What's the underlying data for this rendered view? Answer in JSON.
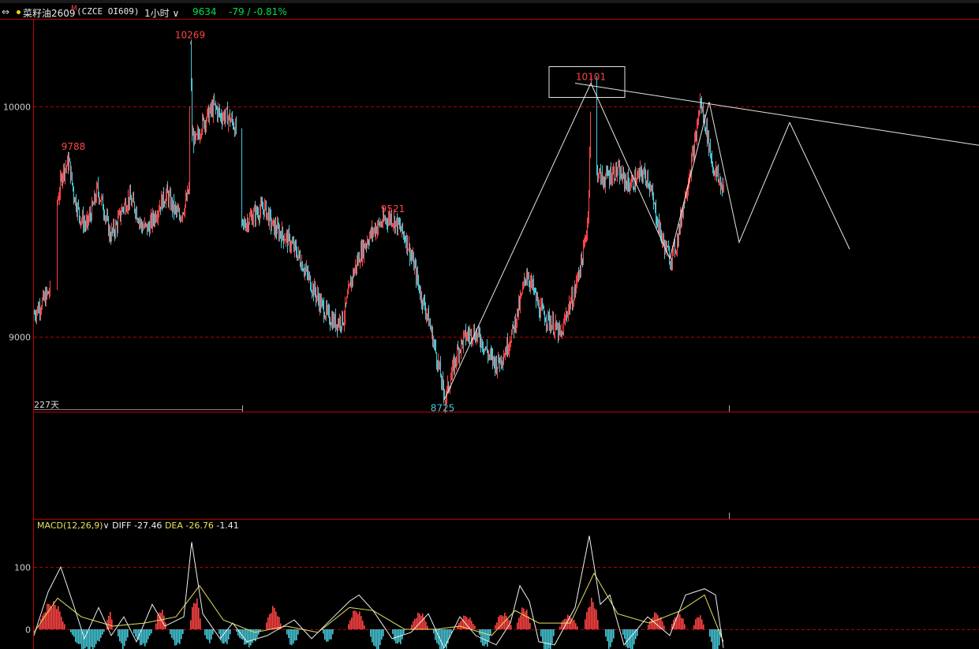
{
  "header": {
    "menu_icon": "⇔",
    "dot_color": "#ffd200",
    "instrument_name": "菜籽油2609",
    "superscript": "M",
    "code": "(CZCE OI609)",
    "period": "1小时",
    "last_price": "9634",
    "change": "-79 / -0.81%"
  },
  "colors": {
    "up": "#ff4444",
    "down": "#46c8d8",
    "grid": "#b40000",
    "axis": "#c00000",
    "white": "#e6e6e6",
    "price_text": "#ffff00",
    "change_text": "#00e050",
    "diff_line": "#f0f0f0",
    "dea_line": "#e8e060"
  },
  "chart_data": [
    {
      "type": "candlestick",
      "yticks": [
        10000,
        9000
      ],
      "ylim": [
        8680,
        10360
      ],
      "span_label": "227天",
      "annotations": [
        {
          "label": "10269",
          "kind": "high"
        },
        {
          "label": "9788",
          "kind": "high"
        },
        {
          "label": "9521",
          "kind": "high"
        },
        {
          "label": "10101",
          "kind": "high"
        },
        {
          "label": "8725",
          "kind": "low"
        }
      ],
      "price_path": [
        [
          0,
          9100
        ],
        [
          10,
          9150
        ],
        [
          20,
          9200
        ],
        [
          28,
          9560
        ],
        [
          36,
          9720
        ],
        [
          44,
          9760
        ],
        [
          50,
          9620
        ],
        [
          58,
          9520
        ],
        [
          66,
          9480
        ],
        [
          74,
          9560
        ],
        [
          80,
          9640
        ],
        [
          88,
          9560
        ],
        [
          96,
          9440
        ],
        [
          104,
          9480
        ],
        [
          112,
          9560
        ],
        [
          120,
          9600
        ],
        [
          128,
          9560
        ],
        [
          136,
          9480
        ],
        [
          144,
          9470
        ],
        [
          152,
          9520
        ],
        [
          160,
          9580
        ],
        [
          168,
          9620
        ],
        [
          176,
          9560
        ],
        [
          184,
          9520
        ],
        [
          192,
          9580
        ],
        [
          196,
          9640
        ],
        [
          198,
          10269
        ],
        [
          200,
          9880
        ],
        [
          204,
          9840
        ],
        [
          212,
          9920
        ],
        [
          220,
          9960
        ],
        [
          228,
          10000
        ],
        [
          236,
          9960
        ],
        [
          244,
          9960
        ],
        [
          252,
          9930
        ],
        [
          256,
          9890
        ],
        [
          262,
          9470
        ],
        [
          272,
          9510
        ],
        [
          282,
          9540
        ],
        [
          292,
          9560
        ],
        [
          302,
          9480
        ],
        [
          312,
          9450
        ],
        [
          322,
          9420
        ],
        [
          332,
          9370
        ],
        [
          342,
          9300
        ],
        [
          352,
          9220
        ],
        [
          362,
          9150
        ],
        [
          372,
          9090
        ],
        [
          382,
          9060
        ],
        [
          392,
          9080
        ],
        [
          402,
          9250
        ],
        [
          412,
          9350
        ],
        [
          422,
          9420
        ],
        [
          432,
          9470
        ],
        [
          442,
          9500
        ],
        [
          452,
          9521
        ],
        [
          462,
          9480
        ],
        [
          472,
          9420
        ],
        [
          482,
          9300
        ],
        [
          490,
          9180
        ],
        [
          498,
          9100
        ],
        [
          506,
          8980
        ],
        [
          514,
          8850
        ],
        [
          520,
          8725
        ],
        [
          528,
          8820
        ],
        [
          536,
          8930
        ],
        [
          546,
          9000
        ],
        [
          556,
          9020
        ],
        [
          566,
          8990
        ],
        [
          576,
          8920
        ],
        [
          586,
          8880
        ],
        [
          596,
          8930
        ],
        [
          606,
          9020
        ],
        [
          616,
          9150
        ],
        [
          624,
          9280
        ],
        [
          632,
          9210
        ],
        [
          640,
          9120
        ],
        [
          650,
          9080
        ],
        [
          660,
          9040
        ],
        [
          668,
          9000
        ],
        [
          676,
          9120
        ],
        [
          684,
          9180
        ],
        [
          690,
          9280
        ],
        [
          696,
          9360
        ],
        [
          702,
          9520
        ],
        [
          706,
          10101
        ],
        [
          712,
          9730
        ],
        [
          720,
          9680
        ],
        [
          728,
          9700
        ],
        [
          738,
          9720
        ],
        [
          746,
          9690
        ],
        [
          754,
          9660
        ],
        [
          762,
          9680
        ],
        [
          770,
          9710
        ],
        [
          778,
          9690
        ],
        [
          786,
          9560
        ],
        [
          796,
          9420
        ],
        [
          806,
          9340
        ],
        [
          814,
          9400
        ],
        [
          822,
          9560
        ],
        [
          830,
          9700
        ],
        [
          838,
          9850
        ],
        [
          844,
          10020
        ],
        [
          852,
          9900
        ],
        [
          860,
          9740
        ],
        [
          868,
          9680
        ],
        [
          874,
          9634
        ]
      ],
      "pattern_lines": [
        {
          "kind": "zigzag",
          "points": [
            [
              520,
              8725
            ],
            [
              706,
              10101
            ],
            [
              806,
              9340
            ],
            [
              856,
              10020
            ],
            [
              894,
              9410
            ],
            [
              958,
              9930
            ],
            [
              1034,
              9380
            ]
          ]
        },
        {
          "kind": "trendline",
          "points": [
            [
              686,
              10101
            ],
            [
              1200,
              9830
            ]
          ]
        }
      ],
      "marked_box": "10101"
    },
    {
      "type": "macd",
      "label": "MACD(12,26,9)",
      "diff": "DIFF -27.46",
      "dea": "DEA -26.76",
      "macd": "-1.41",
      "yticks": [
        100,
        0
      ],
      "ylim": [
        -40,
        150
      ],
      "diff_path": [
        [
          0,
          -10
        ],
        [
          18,
          60
        ],
        [
          34,
          100
        ],
        [
          50,
          40
        ],
        [
          64,
          -15
        ],
        [
          82,
          35
        ],
        [
          98,
          -10
        ],
        [
          114,
          20
        ],
        [
          130,
          -20
        ],
        [
          150,
          40
        ],
        [
          166,
          5
        ],
        [
          190,
          20
        ],
        [
          200,
          140
        ],
        [
          214,
          25
        ],
        [
          236,
          -15
        ],
        [
          252,
          10
        ],
        [
          270,
          -20
        ],
        [
          296,
          -10
        ],
        [
          330,
          15
        ],
        [
          352,
          -15
        ],
        [
          380,
          20
        ],
        [
          400,
          45
        ],
        [
          412,
          55
        ],
        [
          430,
          30
        ],
        [
          454,
          -15
        ],
        [
          478,
          -5
        ],
        [
          500,
          25
        ],
        [
          520,
          -30
        ],
        [
          540,
          20
        ],
        [
          560,
          -10
        ],
        [
          586,
          -25
        ],
        [
          604,
          10
        ],
        [
          616,
          70
        ],
        [
          628,
          45
        ],
        [
          640,
          -20
        ],
        [
          660,
          -25
        ],
        [
          686,
          35
        ],
        [
          704,
          150
        ],
        [
          718,
          40
        ],
        [
          730,
          55
        ],
        [
          748,
          -25
        ],
        [
          778,
          20
        ],
        [
          806,
          -10
        ],
        [
          826,
          55
        ],
        [
          850,
          65
        ],
        [
          864,
          55
        ],
        [
          874,
          -30
        ]
      ],
      "dea_path": [
        [
          0,
          -5
        ],
        [
          30,
          50
        ],
        [
          60,
          20
        ],
        [
          100,
          5
        ],
        [
          140,
          10
        ],
        [
          180,
          20
        ],
        [
          210,
          70
        ],
        [
          240,
          15
        ],
        [
          280,
          -5
        ],
        [
          320,
          5
        ],
        [
          360,
          -5
        ],
        [
          400,
          35
        ],
        [
          430,
          30
        ],
        [
          470,
          0
        ],
        [
          510,
          0
        ],
        [
          540,
          5
        ],
        [
          580,
          -10
        ],
        [
          610,
          30
        ],
        [
          640,
          10
        ],
        [
          680,
          10
        ],
        [
          710,
          90
        ],
        [
          740,
          25
        ],
        [
          780,
          10
        ],
        [
          820,
          30
        ],
        [
          850,
          55
        ],
        [
          874,
          -20
        ]
      ],
      "hist_blocks": [
        [
          4,
          40,
          50
        ],
        [
          44,
          90,
          -40
        ],
        [
          90,
          100,
          30
        ],
        [
          104,
          120,
          -35
        ],
        [
          124,
          150,
          -30
        ],
        [
          152,
          168,
          35
        ],
        [
          170,
          190,
          -30
        ],
        [
          196,
          212,
          55
        ],
        [
          214,
          228,
          -25
        ],
        [
          232,
          250,
          -30
        ],
        [
          254,
          288,
          -30
        ],
        [
          292,
          314,
          40
        ],
        [
          318,
          336,
          -30
        ],
        [
          364,
          380,
          -25
        ],
        [
          396,
          420,
          35
        ],
        [
          424,
          444,
          -40
        ],
        [
          452,
          470,
          -30
        ],
        [
          476,
          500,
          30
        ],
        [
          504,
          530,
          -40
        ],
        [
          534,
          560,
          25
        ],
        [
          562,
          580,
          -35
        ],
        [
          582,
          606,
          30
        ],
        [
          610,
          630,
          40
        ],
        [
          640,
          660,
          -45
        ],
        [
          664,
          690,
          25
        ],
        [
          696,
          716,
          55
        ],
        [
          722,
          736,
          -35
        ],
        [
          744,
          766,
          -40
        ],
        [
          776,
          800,
          30
        ],
        [
          806,
          826,
          30
        ],
        [
          834,
          850,
          25
        ],
        [
          854,
          872,
          -45
        ]
      ]
    }
  ]
}
